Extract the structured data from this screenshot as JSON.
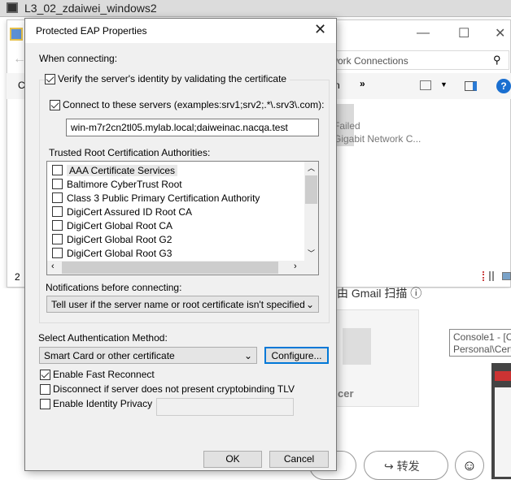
{
  "host": {
    "title": "L3_02_zdaiwei_windows2"
  },
  "explorer": {
    "address": "twork Connections",
    "toolbar_partial": "n",
    "more": "»",
    "item_status": "Failed",
    "item_adapter": "Gigabit Network C...",
    "left_c": "C",
    "left_2": "2"
  },
  "gmail": {
    "scanned": "已由 Gmail 扫描",
    "attachment_ext": "cer",
    "forward": "转发"
  },
  "tooltip": {
    "line1": "Console1 - [C",
    "line2": "Personal\\Cert"
  },
  "dialog": {
    "title": "Protected EAP Properties",
    "when_connecting": "When connecting:",
    "verify": {
      "label": "Verify the server's identity by validating the certificate",
      "checked": true
    },
    "connect": {
      "label": "Connect to these servers (examples:srv1;srv2;.*\\.srv3\\.com):",
      "checked": true
    },
    "servers": "win-m7r2cn2tl05.mylab.local;daiweinac.nacqa.test",
    "trusted_label": "Trusted Root Certification Authorities:",
    "cas": [
      {
        "name": "AAA Certificate Services",
        "checked": false
      },
      {
        "name": "Baltimore CyberTrust Root",
        "checked": false
      },
      {
        "name": "Class 3 Public Primary Certification Authority",
        "checked": false
      },
      {
        "name": "DigiCert Assured ID Root CA",
        "checked": false
      },
      {
        "name": "DigiCert Global Root CA",
        "checked": false
      },
      {
        "name": "DigiCert Global Root G2",
        "checked": false
      },
      {
        "name": "DigiCert Global Root G3",
        "checked": false
      }
    ],
    "notif_label": "Notifications before connecting:",
    "notif_value": "Tell user if the server name or root certificate isn't specified",
    "auth_label": "Select Authentication Method:",
    "auth_value": "Smart Card or other certificate",
    "configure": "Configure...",
    "fast_reconnect": {
      "label": "Enable Fast Reconnect",
      "checked": true
    },
    "cryptobinding": {
      "label": "Disconnect if server does not present cryptobinding TLV",
      "checked": false
    },
    "identity_privacy": {
      "label": "Enable Identity Privacy",
      "checked": false
    },
    "ok": "OK",
    "cancel": "Cancel"
  }
}
